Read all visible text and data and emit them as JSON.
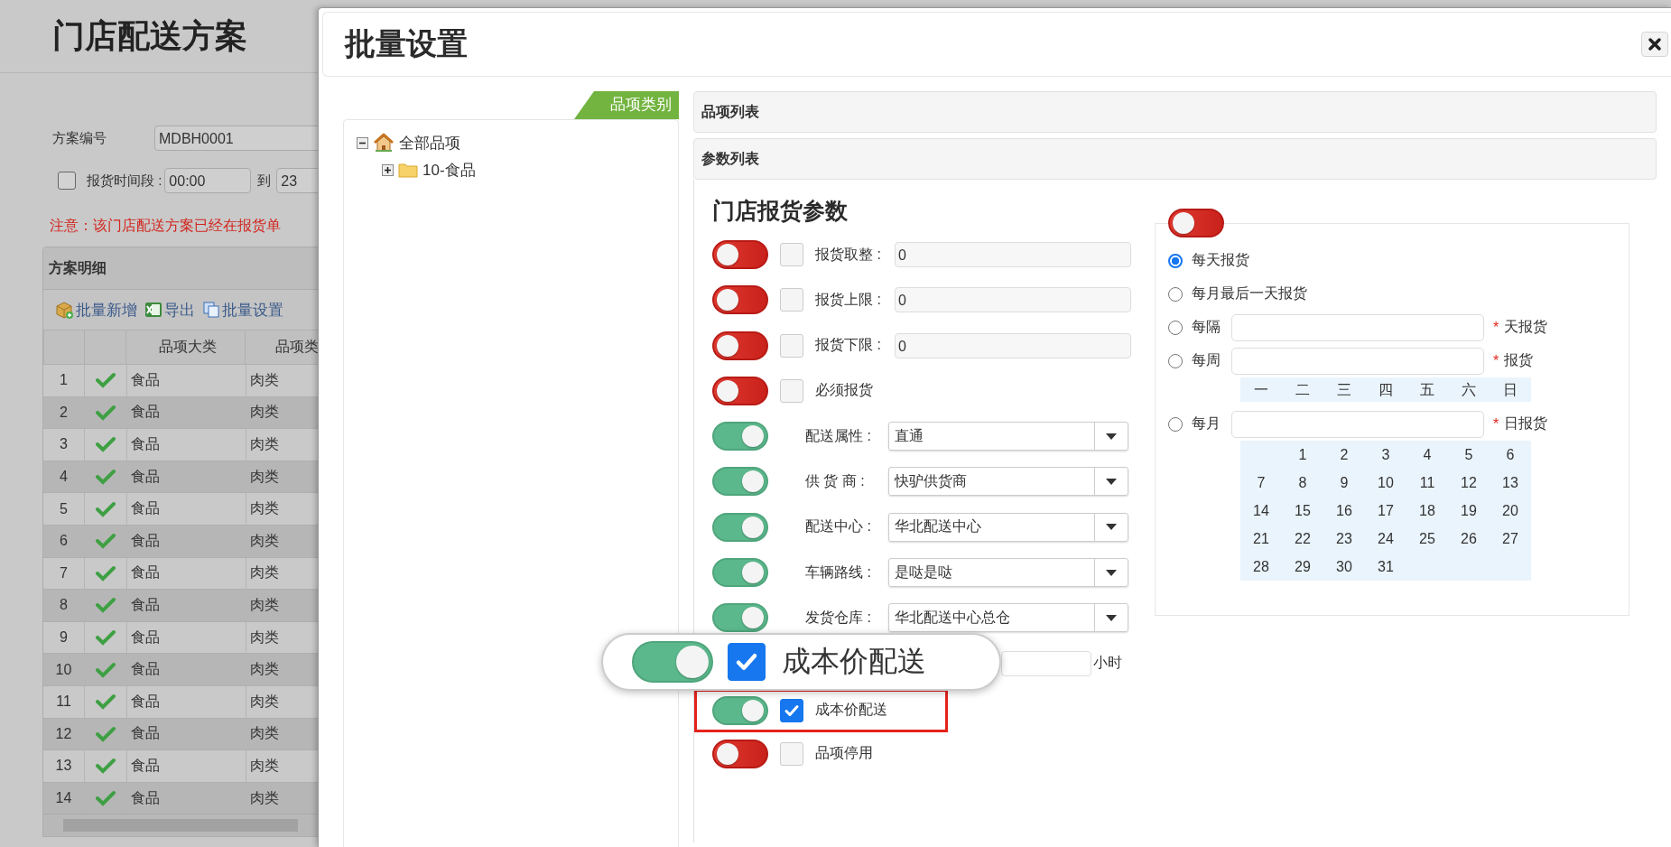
{
  "page": {
    "title": "门店配送方案",
    "plan_no": {
      "label": "方案编号",
      "value": "MDBH0001"
    },
    "time_range": {
      "checked": false,
      "label": "报货时间段 :",
      "from": "00:00",
      "to_label": "到",
      "to": "23"
    },
    "notice": "注意：该门店配送方案已经在报货单",
    "panel_title": "方案明细",
    "toolbar": [
      {
        "kind": "add",
        "label": "批量新增"
      },
      {
        "kind": "export",
        "label": "导出"
      },
      {
        "kind": "batch",
        "label": "批量设置"
      }
    ],
    "table": {
      "columns": [
        "品项大类",
        "品项类"
      ],
      "rows": [
        {
          "index": "1",
          "ok": true,
          "cells": [
            "食品",
            "肉类"
          ]
        },
        {
          "index": "2",
          "ok": true,
          "cells": [
            "食品",
            "肉类"
          ]
        },
        {
          "index": "3",
          "ok": true,
          "cells": [
            "食品",
            "肉类"
          ]
        },
        {
          "index": "4",
          "ok": true,
          "cells": [
            "食品",
            "肉类"
          ]
        },
        {
          "index": "5",
          "ok": true,
          "cells": [
            "食品",
            "肉类"
          ]
        },
        {
          "index": "6",
          "ok": true,
          "cells": [
            "食品",
            "肉类"
          ]
        },
        {
          "index": "7",
          "ok": true,
          "cells": [
            "食品",
            "肉类"
          ]
        },
        {
          "index": "8",
          "ok": true,
          "cells": [
            "食品",
            "肉类"
          ]
        },
        {
          "index": "9",
          "ok": true,
          "cells": [
            "食品",
            "肉类"
          ]
        },
        {
          "index": "10",
          "ok": true,
          "cells": [
            "食品",
            "肉类"
          ]
        },
        {
          "index": "11",
          "ok": true,
          "cells": [
            "食品",
            "肉类"
          ]
        },
        {
          "index": "12",
          "ok": true,
          "cells": [
            "食品",
            "肉类"
          ]
        },
        {
          "index": "13",
          "ok": true,
          "cells": [
            "食品",
            "肉类"
          ]
        },
        {
          "index": "14",
          "ok": true,
          "cells": [
            "食品",
            "肉类"
          ]
        }
      ]
    }
  },
  "dialog": {
    "title": "批量设置",
    "tree": {
      "tab": "品项类别",
      "items": [
        {
          "label": "全部品项",
          "expanded": true,
          "children": [
            {
              "label": "10-食品",
              "expanded": false
            }
          ]
        }
      ]
    },
    "item_list_header": "品项列表",
    "param_list_header": "参数列表",
    "params_title": "门店报货参数",
    "params": [
      {
        "kind": "number",
        "on": false,
        "checked": false,
        "label": "报货取整 :",
        "value": "0"
      },
      {
        "kind": "number",
        "on": false,
        "checked": false,
        "label": "报货上限 :",
        "value": "0"
      },
      {
        "kind": "number",
        "on": false,
        "checked": false,
        "label": "报货下限 :",
        "value": "0"
      },
      {
        "kind": "check",
        "on": false,
        "checked": false,
        "label": "必须报货",
        "highlighted": false
      },
      {
        "kind": "select",
        "on": true,
        "label": "配送属性 :",
        "value": "直通"
      },
      {
        "kind": "select",
        "on": true,
        "label": "供 货 商 :",
        "value": "快驴供货商"
      },
      {
        "kind": "select",
        "on": true,
        "label": "配送中心 :",
        "value": "华北配送中心"
      },
      {
        "kind": "select",
        "on": true,
        "label": "车辆路线 :",
        "value": "是哒是哒"
      },
      {
        "kind": "select",
        "on": true,
        "label": "发货仓库 :",
        "value": "华北配送中心总仓"
      },
      {
        "kind": "hours",
        "unit": "小时"
      },
      {
        "kind": "check",
        "on": true,
        "checked": true,
        "label": "成本价配送",
        "highlighted": true
      },
      {
        "kind": "check",
        "on": false,
        "checked": false,
        "label": "品项停用",
        "highlighted": false
      }
    ],
    "schedule": {
      "on": false,
      "options": [
        {
          "kind": "plain",
          "label": "每天报货",
          "selected": true
        },
        {
          "kind": "plain",
          "label": "每月最后一天报货",
          "selected": false
        },
        {
          "kind": "field",
          "label": "每隔",
          "mark": "*",
          "suffix": "天报货",
          "selected": false
        },
        {
          "kind": "field",
          "label": "每周",
          "mark": "*",
          "suffix": "报货",
          "selected": false,
          "weekdays": [
            "一",
            "二",
            "三",
            "四",
            "五",
            "六",
            "日"
          ]
        },
        {
          "kind": "field",
          "label": "每月",
          "mark": "*",
          "suffix": "日报货",
          "selected": false,
          "days": [
            "1",
            "2",
            "3",
            "4",
            "5",
            "6",
            "7",
            "8",
            "9",
            "10",
            "11",
            "12",
            "13",
            "14",
            "15",
            "16",
            "17",
            "18",
            "19",
            "20",
            "21",
            "22",
            "23",
            "24",
            "25",
            "26",
            "27",
            "28",
            "29",
            "30",
            "31"
          ]
        }
      ]
    },
    "magnifier": {
      "on": true,
      "checked": true,
      "label": "成本价配送"
    }
  }
}
